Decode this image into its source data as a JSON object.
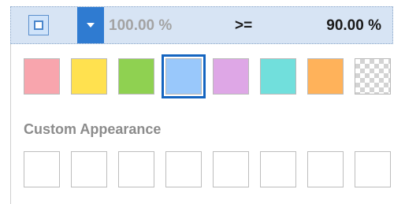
{
  "toolbar": {
    "value_left": "100.00 %",
    "operator": ">=",
    "value_right": "90.00 %"
  },
  "palette": {
    "swatches": [
      {
        "name": "red",
        "color": "#f8a5ad"
      },
      {
        "name": "yellow",
        "color": "#ffe14f"
      },
      {
        "name": "green",
        "color": "#8fd151"
      },
      {
        "name": "blue",
        "color": "#99c8fb",
        "selected": true
      },
      {
        "name": "purple",
        "color": "#dea7e6"
      },
      {
        "name": "cyan",
        "color": "#71dfdc"
      },
      {
        "name": "orange",
        "color": "#ffb25a"
      },
      {
        "name": "transparent",
        "color": "transparent"
      }
    ],
    "selected_border_color": "#1565c0"
  },
  "custom": {
    "label": "Custom Appearance",
    "slot_count": 8
  },
  "icons": {
    "color_button": "square-color-icon",
    "dropdown": "chevron-down-icon"
  }
}
